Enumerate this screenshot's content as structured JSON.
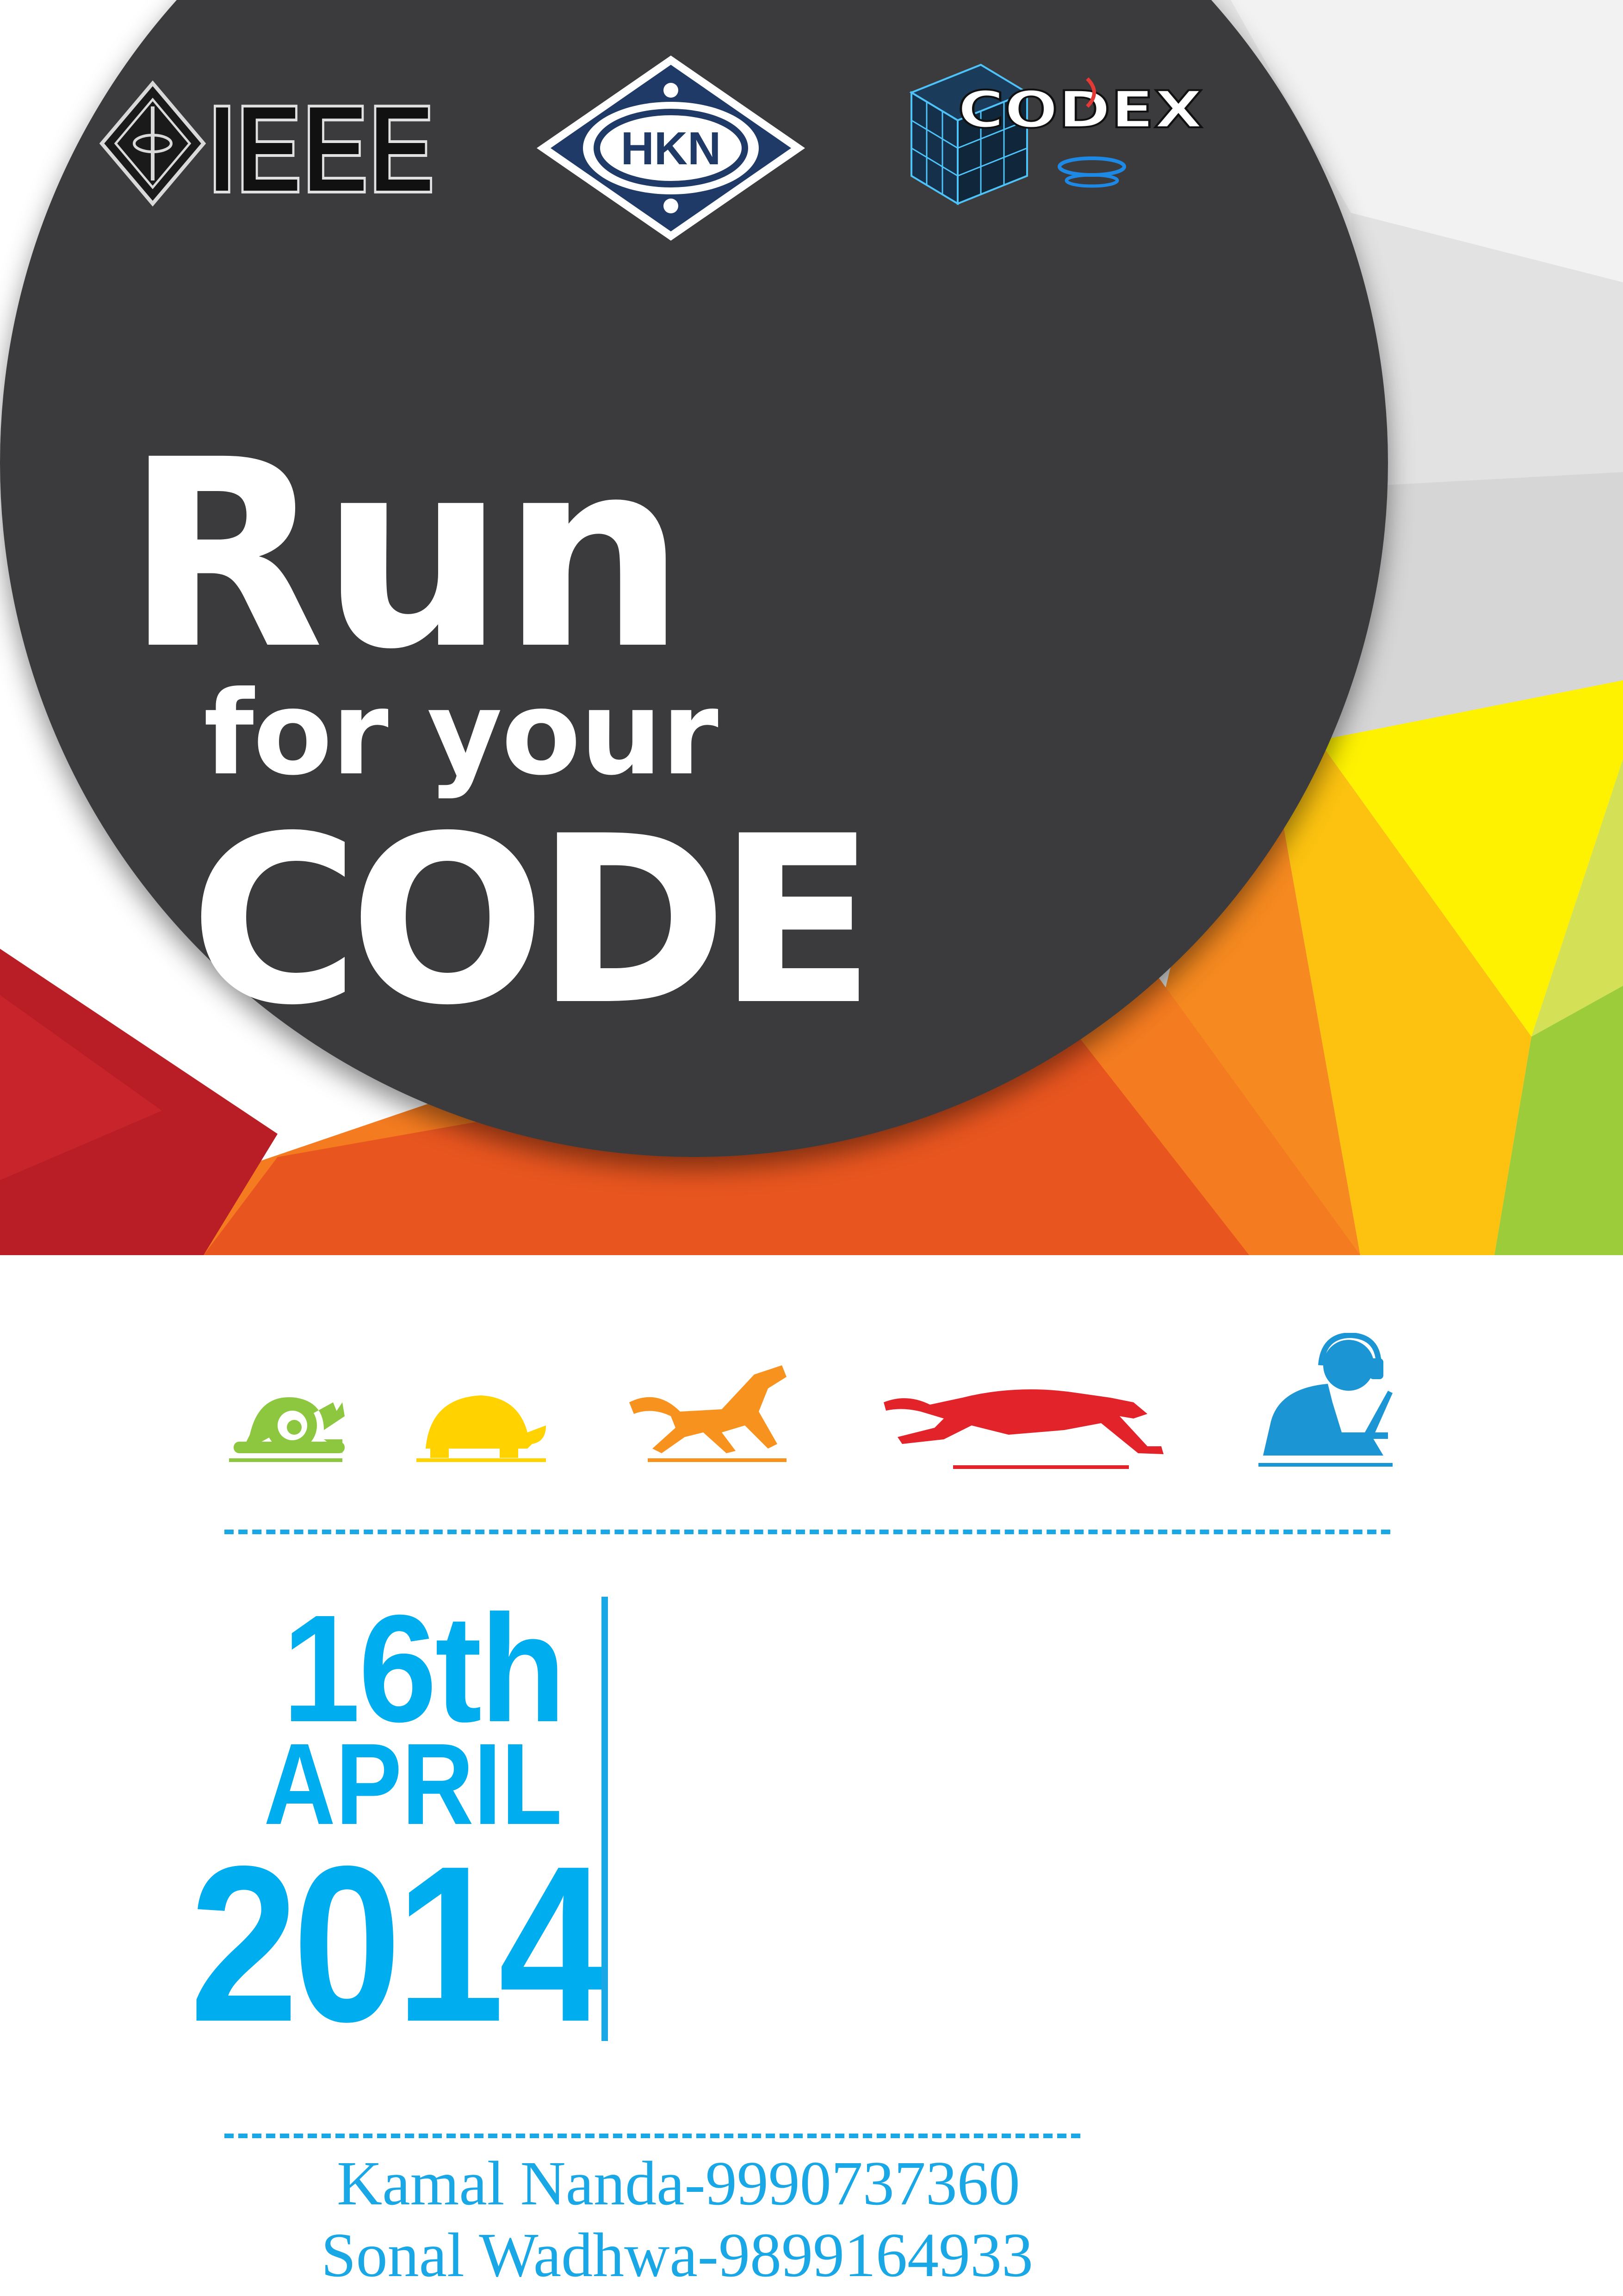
{
  "logos": {
    "ieee": {
      "text": "IEEE"
    },
    "hkn": {
      "text": "HKN"
    },
    "codex": {
      "text": "CODEX"
    }
  },
  "headline": {
    "line1": "Run",
    "line2": "for your",
    "line3": "CODE"
  },
  "speed_icons": [
    "snail-icon",
    "turtle-icon",
    "horse-icon",
    "cheetah-icon",
    "coder-with-laptop-icon"
  ],
  "event_date": {
    "day": "16th",
    "month": "APRIL",
    "year": "2014"
  },
  "contacts": [
    "Kamal Nanda-9990737360",
    "Sonal Wadhwa-9899164933"
  ],
  "colors": {
    "dark_circle": "#3a3a3c",
    "accent_blue": "#1aa7e6",
    "date_blue": "#00aeef",
    "snail": "#8dc63f",
    "turtle": "#ffd200",
    "horse": "#f7921e",
    "cheetah": "#e3232a",
    "coder": "#1b95d4"
  }
}
